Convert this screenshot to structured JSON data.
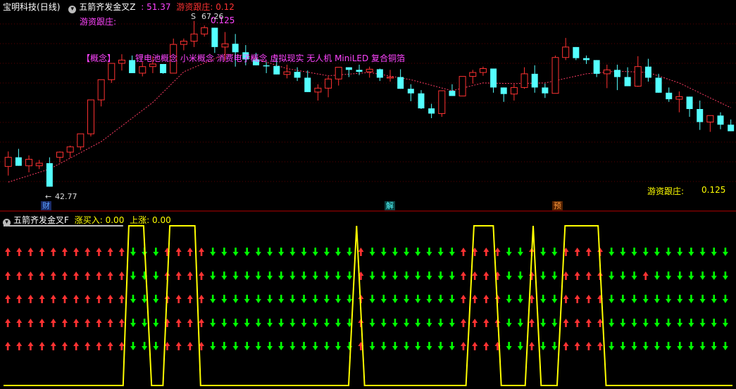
{
  "colors": {
    "bg": "#000000",
    "up": "#ff3232",
    "down": "#54ffff",
    "ma": "#ff3c64",
    "magenta": "#ff44ff",
    "yellow": "#ffff00",
    "white": "#ffffff",
    "green": "#00ff00",
    "divider": "#b40000"
  },
  "top_header": {
    "stock": "宝明科技",
    "period": "(日线)",
    "indicator": "五箭齐发金叉Z",
    "value": ": 51.37",
    "follow_label": "游资跟庄",
    "follow_value": ": 0.12"
  },
  "top_labels": {
    "follow_label": "游资跟庄:",
    "follow_value": "0.125",
    "concept_tag": "【概念】",
    "concepts": "锂电池概念 小米概念 消费电子概念 虚拟现实 无人机 MiniLED 复合铜箔",
    "high_price": "67.26",
    "low_price": "42.77",
    "bottom_follow_label": "游资跟庄:",
    "bottom_follow_value": "0.125",
    "high_mark": "S"
  },
  "tags": [
    {
      "text": "财",
      "color": "#5aa0ff",
      "bg": "#1a2a66",
      "x": 58
    },
    {
      "text": "解",
      "color": "#54ffff",
      "bg": "#0a4444",
      "x": 546
    },
    {
      "text": "预",
      "color": "#ff9a3c",
      "bg": "#552200",
      "x": 784
    }
  ],
  "bottom_header": {
    "indicator": "五箭齐发金叉F",
    "buy_label": "涨买入",
    "buy_value": ": 0.00",
    "rise_label": "上涨",
    "rise_value": ": 0.00"
  },
  "chart_data": {
    "type": "candlestick",
    "candles": [
      [
        1,
        46.0,
        48.3,
        44.6,
        47.4
      ],
      [
        2,
        47.4,
        48.7,
        46.6,
        46.1
      ],
      [
        3,
        46.1,
        47.7,
        45.1,
        47.1
      ],
      [
        4,
        46.1,
        47.0,
        45.6,
        46.5
      ],
      [
        5,
        46.5,
        47.4,
        44.9,
        42.9
      ],
      [
        6,
        47.4,
        48.3,
        46.6,
        48.2
      ],
      [
        7,
        48.2,
        49.2,
        47.3,
        49.0
      ],
      [
        8,
        49.0,
        50.6,
        48.5,
        51.0
      ],
      [
        9,
        51.0,
        55.9,
        50.6,
        56.2
      ],
      [
        10,
        56.2,
        57.9,
        55.2,
        59.3
      ],
      [
        11,
        59.3,
        61.7,
        58.8,
        61.8
      ],
      [
        12,
        61.8,
        63.2,
        60.7,
        62.3
      ],
      [
        13,
        62.3,
        63.0,
        60.8,
        60.3
      ],
      [
        14,
        60.3,
        62.0,
        59.8,
        61.3
      ],
      [
        15,
        61.3,
        62.9,
        60.3,
        61.7
      ],
      [
        16,
        61.7,
        61.2,
        60.2,
        60.3
      ],
      [
        17,
        60.3,
        65.6,
        60.4,
        64.7
      ],
      [
        18,
        64.7,
        65.6,
        63.8,
        65.2
      ],
      [
        19,
        65.2,
        68.3,
        64.3,
        66.3
      ],
      [
        20,
        66.3,
        67.6,
        65.9,
        67.26
      ],
      [
        21,
        67.26,
        66.9,
        63.4,
        64.3
      ],
      [
        22,
        64.3,
        66.6,
        62.2,
        64.8
      ],
      [
        23,
        64.8,
        66.3,
        61.3,
        63.5
      ],
      [
        24,
        63.5,
        64.6,
        61.5,
        62.4
      ],
      [
        25,
        62.4,
        63.4,
        61.9,
        61.5
      ],
      [
        26,
        61.5,
        62.0,
        60.3,
        61.4
      ],
      [
        27,
        61.4,
        62.6,
        60.8,
        60.1
      ],
      [
        28,
        60.1,
        61.6,
        59.5,
        60.5
      ],
      [
        29,
        60.5,
        61.2,
        59.1,
        59.6
      ],
      [
        30,
        59.6,
        60.7,
        58.1,
        57.4
      ],
      [
        31,
        57.4,
        58.6,
        56.1,
        58.0
      ],
      [
        32,
        58.0,
        59.8,
        56.6,
        59.4
      ],
      [
        33,
        59.4,
        60.9,
        58.4,
        61.2
      ],
      [
        34,
        61.2,
        61.1,
        59.7,
        60.8
      ],
      [
        35,
        60.8,
        61.6,
        60.0,
        60.5
      ],
      [
        36,
        60.5,
        61.3,
        59.6,
        60.9
      ],
      [
        37,
        60.9,
        61.0,
        59.1,
        59.6
      ],
      [
        38,
        59.6,
        60.8,
        59.0,
        59.7
      ],
      [
        39,
        59.7,
        60.9,
        58.3,
        57.9
      ],
      [
        40,
        57.9,
        58.6,
        56.0,
        57.2
      ],
      [
        41,
        57.2,
        57.7,
        54.8,
        54.9
      ],
      [
        42,
        54.9,
        55.6,
        53.4,
        54.1
      ],
      [
        43,
        54.1,
        56.3,
        53.6,
        57.6
      ],
      [
        44,
        57.6,
        58.6,
        56.9,
        56.8
      ],
      [
        45,
        56.8,
        59.7,
        56.9,
        59.8
      ],
      [
        46,
        59.8,
        60.8,
        58.7,
        60.4
      ],
      [
        47,
        60.4,
        61.3,
        59.9,
        61.0
      ],
      [
        48,
        61.0,
        60.9,
        57.3,
        58.1
      ],
      [
        49,
        58.1,
        57.7,
        55.9,
        57.1
      ],
      [
        50,
        57.1,
        58.6,
        56.1,
        58.1
      ],
      [
        51,
        58.1,
        61.2,
        57.9,
        60.2
      ],
      [
        52,
        60.2,
        61.5,
        57.3,
        58.1
      ],
      [
        53,
        58.1,
        58.7,
        56.5,
        57.2
      ],
      [
        54,
        57.2,
        63.0,
        57.5,
        62.7
      ],
      [
        55,
        62.7,
        65.7,
        62.3,
        64.3
      ],
      [
        56,
        64.3,
        64.0,
        62.3,
        62.6
      ],
      [
        57,
        62.6,
        63.0,
        61.7,
        62.3
      ],
      [
        58,
        62.3,
        61.7,
        59.7,
        60.2
      ],
      [
        59,
        60.2,
        61.6,
        58.0,
        60.8
      ],
      [
        60,
        60.8,
        61.6,
        57.7,
        59.7
      ],
      [
        61,
        59.7,
        61.2,
        58.3,
        58.3
      ],
      [
        62,
        58.3,
        62.9,
        58.2,
        61.3
      ],
      [
        63,
        61.3,
        62.5,
        59.0,
        59.6
      ],
      [
        64,
        59.6,
        60.2,
        57.8,
        57.3
      ],
      [
        65,
        57.3,
        58.1,
        55.9,
        56.3
      ],
      [
        66,
        56.3,
        57.5,
        54.3,
        56.7
      ],
      [
        67,
        56.7,
        56.0,
        53.6,
        54.8
      ],
      [
        68,
        54.8,
        56.1,
        51.6,
        52.8
      ],
      [
        69,
        52.8,
        53.7,
        51.3,
        53.8
      ],
      [
        70,
        53.8,
        54.3,
        51.7,
        52.4
      ],
      [
        71,
        52.4,
        53.2,
        51.7,
        51.4
      ]
    ],
    "ma": [
      [
        1,
        43.6
      ],
      [
        5,
        45.6
      ],
      [
        10,
        49.8
      ],
      [
        15,
        55.8
      ],
      [
        18,
        60.5
      ],
      [
        22,
        63.2
      ],
      [
        24,
        63.0
      ],
      [
        28,
        61.0
      ],
      [
        32,
        59.9
      ],
      [
        36,
        60.4
      ],
      [
        40,
        59.3
      ],
      [
        44,
        57.6
      ],
      [
        47,
        58.8
      ],
      [
        50,
        58.7
      ],
      [
        53,
        58.8
      ],
      [
        57,
        60.2
      ],
      [
        60,
        60.6
      ],
      [
        63,
        60.4
      ],
      [
        66,
        58.8
      ],
      [
        69,
        56.5
      ],
      [
        71,
        55.0
      ]
    ],
    "ylim": [
      41,
      70
    ],
    "xlim": [
      0.2,
      71.5
    ],
    "high": 67.26,
    "low": 42.77
  },
  "sub_chart": {
    "line": [
      [
        0,
        0
      ],
      [
        10.5,
        0
      ],
      [
        11,
        1
      ],
      [
        12.3,
        1
      ],
      [
        13,
        0
      ],
      [
        14,
        0
      ],
      [
        14.6,
        1
      ],
      [
        16.8,
        1
      ],
      [
        17.3,
        0
      ],
      [
        30.3,
        0
      ],
      [
        31,
        1
      ],
      [
        31.7,
        0
      ],
      [
        40.6,
        0
      ],
      [
        41.3,
        1
      ],
      [
        43,
        1
      ],
      [
        43.7,
        0
      ],
      [
        45.8,
        0
      ],
      [
        46.5,
        1
      ],
      [
        47.2,
        0
      ],
      [
        48.6,
        0
      ],
      [
        49.3,
        1
      ],
      [
        52.2,
        1
      ],
      [
        52.9,
        0
      ],
      [
        64,
        0
      ]
    ],
    "xlim": [
      0,
      64
    ],
    "arrow_cols": 64,
    "arrow_rows": 5,
    "arrow_pattern": [
      [
        0,
        10,
        "up"
      ],
      [
        11,
        13,
        "down"
      ],
      [
        14,
        17,
        "up"
      ],
      [
        18,
        30,
        "down"
      ],
      [
        31,
        31,
        "up"
      ],
      [
        32,
        39,
        "down"
      ],
      [
        40,
        43,
        "up"
      ],
      [
        44,
        45,
        "down"
      ],
      [
        46,
        46,
        "up"
      ],
      [
        47,
        48,
        "down"
      ],
      [
        49,
        52,
        "up"
      ],
      [
        53,
        63,
        "down"
      ]
    ],
    "exceptions": [
      [
        1,
        56,
        "up"
      ],
      [
        2,
        0,
        "up"
      ]
    ]
  }
}
